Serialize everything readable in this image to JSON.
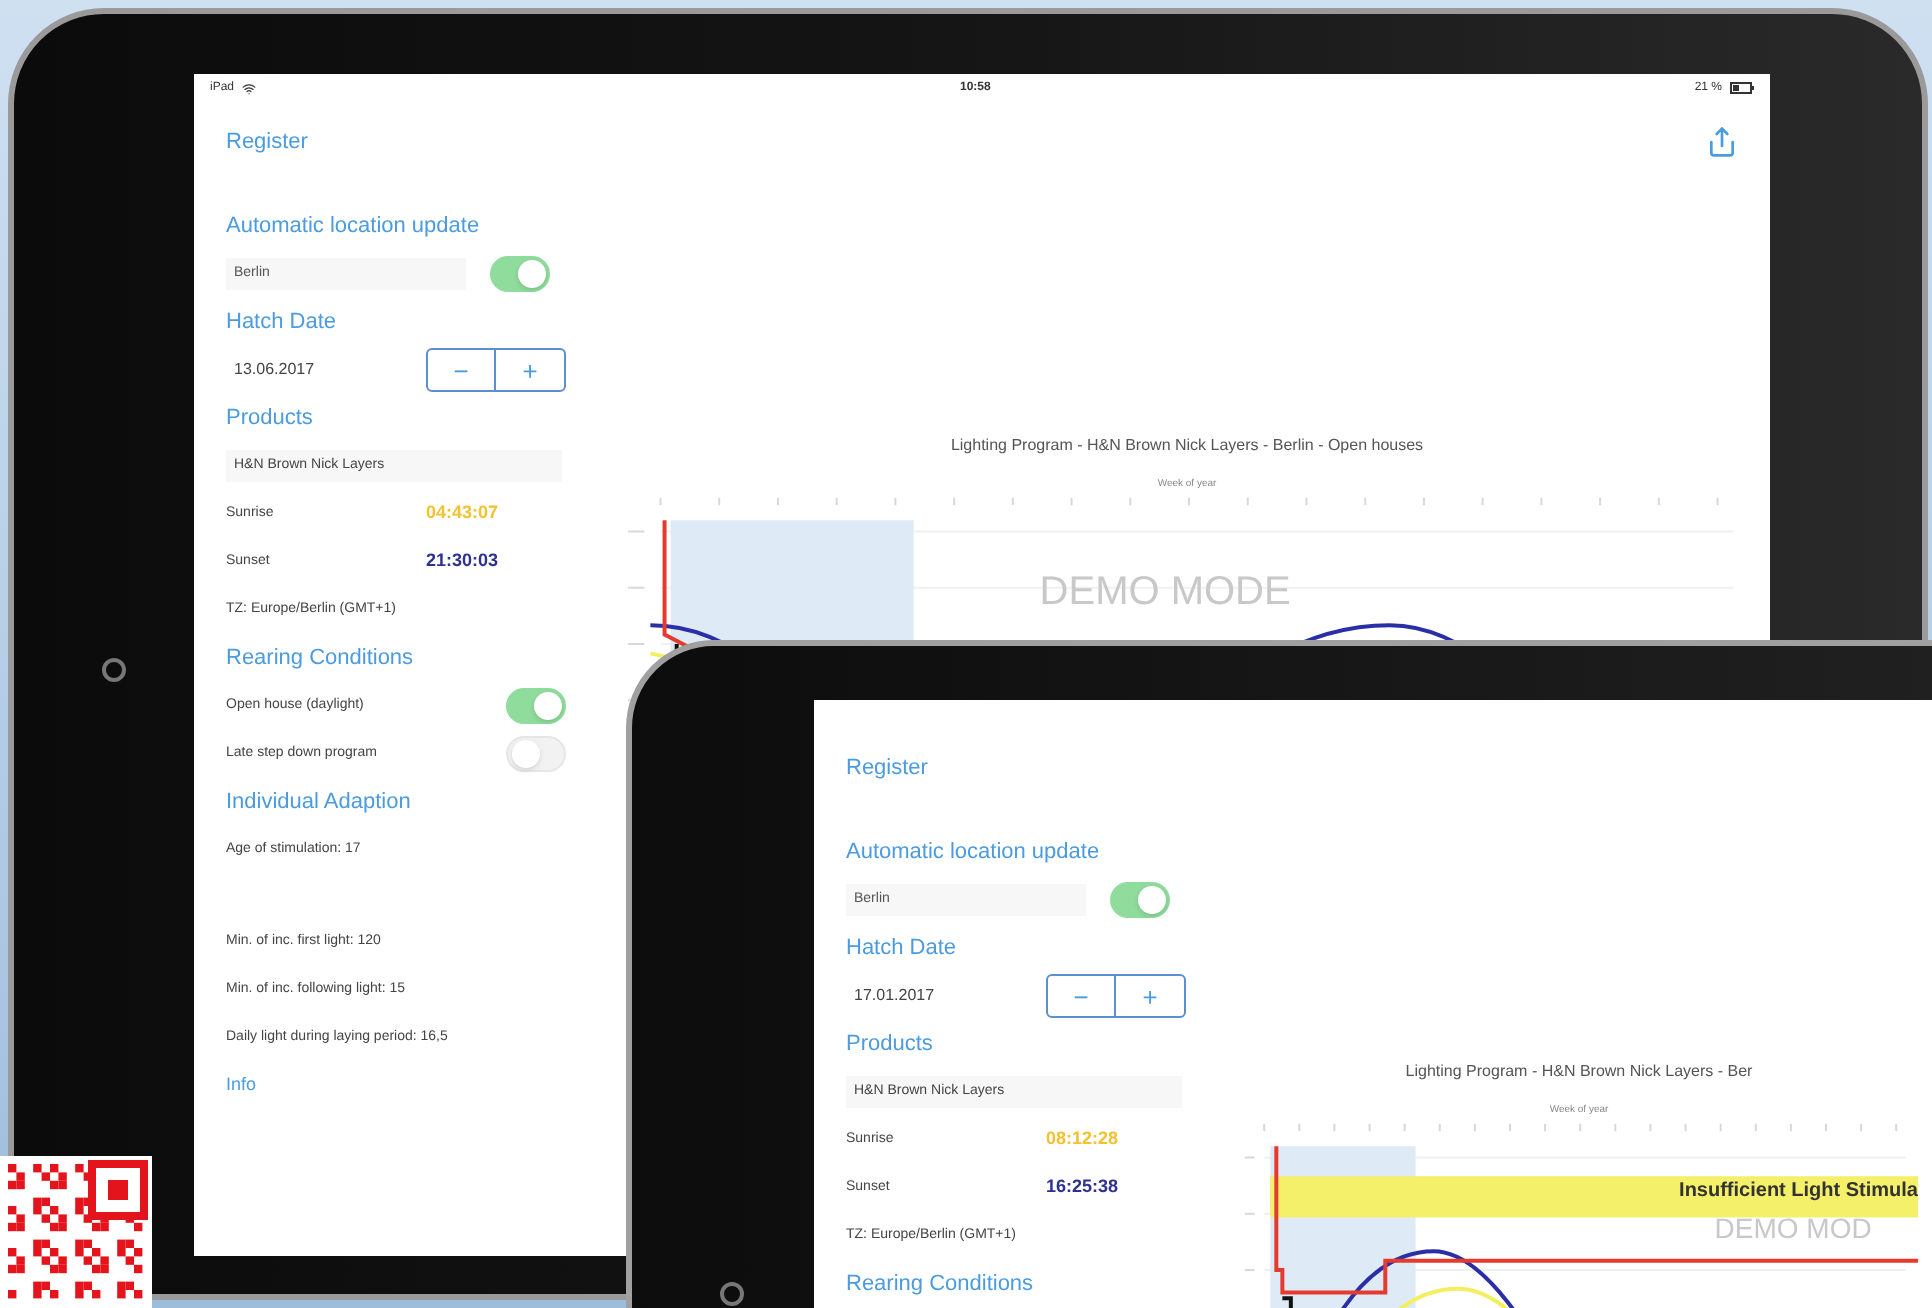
{
  "tablets": [
    {
      "status_bar": {
        "device": "iPad",
        "time": "10:58",
        "battery": "21 %"
      },
      "nav_title": "Register",
      "share_button": true,
      "items": [
        {
          "kind": "heading",
          "text": "Automatic location update"
        },
        {
          "kind": "field_toggle",
          "value": "Berlin",
          "on": true
        },
        {
          "kind": "heading",
          "text": "Hatch Date"
        },
        {
          "kind": "stepper",
          "value": "13.06.2017",
          "minus": "−",
          "plus": "+"
        },
        {
          "kind": "heading",
          "text": "Products"
        },
        {
          "kind": "field",
          "value": "H&N Brown Nick Layers"
        },
        {
          "kind": "time",
          "label": "Sunrise",
          "value": "04:43:07",
          "color": "#f2c230"
        },
        {
          "kind": "time",
          "label": "Sunset",
          "value": "21:30:03",
          "color": "#2d3190"
        },
        {
          "kind": "text",
          "text": "TZ: Europe/Berlin (GMT+1)"
        },
        {
          "kind": "heading",
          "text": "Rearing Conditions"
        },
        {
          "kind": "toggle",
          "label": "Open house (daylight)",
          "on": true
        },
        {
          "kind": "toggle",
          "label": "Late step down program",
          "on": false
        },
        {
          "kind": "heading",
          "text": "Individual Adaption"
        },
        {
          "kind": "text",
          "text": "Age of stimulation: 17"
        },
        {
          "kind": "text",
          "text": "Min. of inc. first light: 120"
        },
        {
          "kind": "text",
          "text": "Min. of inc. following light: 15"
        },
        {
          "kind": "text",
          "text": "Daily light during laying period: 16,5"
        },
        {
          "kind": "link",
          "text": "Info"
        }
      ],
      "chart": {
        "title": "Lighting Program - H&N Brown Nick Layers - Berlin - Open houses",
        "axis_label": "Week of year",
        "watermark": "DEMO MODE"
      }
    },
    {
      "nav_title": "Register",
      "share_button": false,
      "items": [
        {
          "kind": "heading",
          "text": "Automatic location update"
        },
        {
          "kind": "field_toggle",
          "value": "Berlin",
          "on": true
        },
        {
          "kind": "heading",
          "text": "Hatch Date"
        },
        {
          "kind": "stepper",
          "value": "17.01.2017",
          "minus": "−",
          "plus": "+"
        },
        {
          "kind": "heading",
          "text": "Products"
        },
        {
          "kind": "field",
          "value": "H&N Brown Nick Layers"
        },
        {
          "kind": "time",
          "label": "Sunrise",
          "value": "08:12:28",
          "color": "#f2c230"
        },
        {
          "kind": "time",
          "label": "Sunset",
          "value": "16:25:38",
          "color": "#2d3190"
        },
        {
          "kind": "text",
          "text": "TZ: Europe/Berlin (GMT+1)"
        },
        {
          "kind": "heading",
          "text": "Rearing Conditions"
        }
      ],
      "chart": {
        "title": "Lighting Program - H&N Brown Nick Layers - Ber",
        "axis_label": "Week of year",
        "watermark": "DEMO MOD",
        "banner": "Insufficient Light Stimula"
      }
    }
  ]
}
